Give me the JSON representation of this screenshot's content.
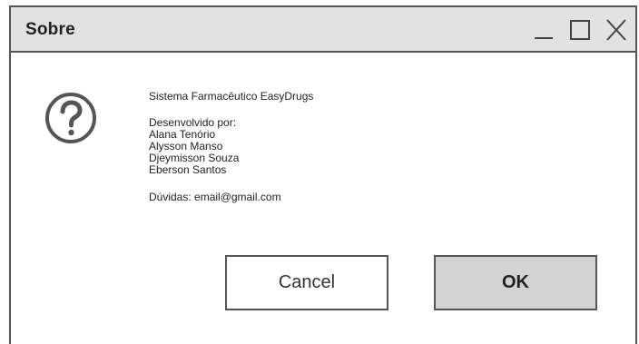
{
  "window": {
    "title": "Sobre",
    "controls": {
      "minimize_icon": "minimize-icon",
      "maximize_icon": "maximize-icon",
      "close_icon": "close-icon"
    }
  },
  "content": {
    "icon": "help-question-icon",
    "app_name": "Sistema Farmacêutico EasyDrugs",
    "developed_by_label": "Desenvolvido por:",
    "developers": [
      "Alana Tenório",
      "Alysson Manso",
      "Djeymisson Souza",
      "Eberson Santos"
    ],
    "contact": "Dúvidas: email@gmail.com"
  },
  "buttons": {
    "cancel_label": "Cancel",
    "ok_label": "OK"
  },
  "colors": {
    "titlebar_bg": "#e2e2e2",
    "border": "#555555",
    "ok_bg": "#d3d3d3"
  }
}
